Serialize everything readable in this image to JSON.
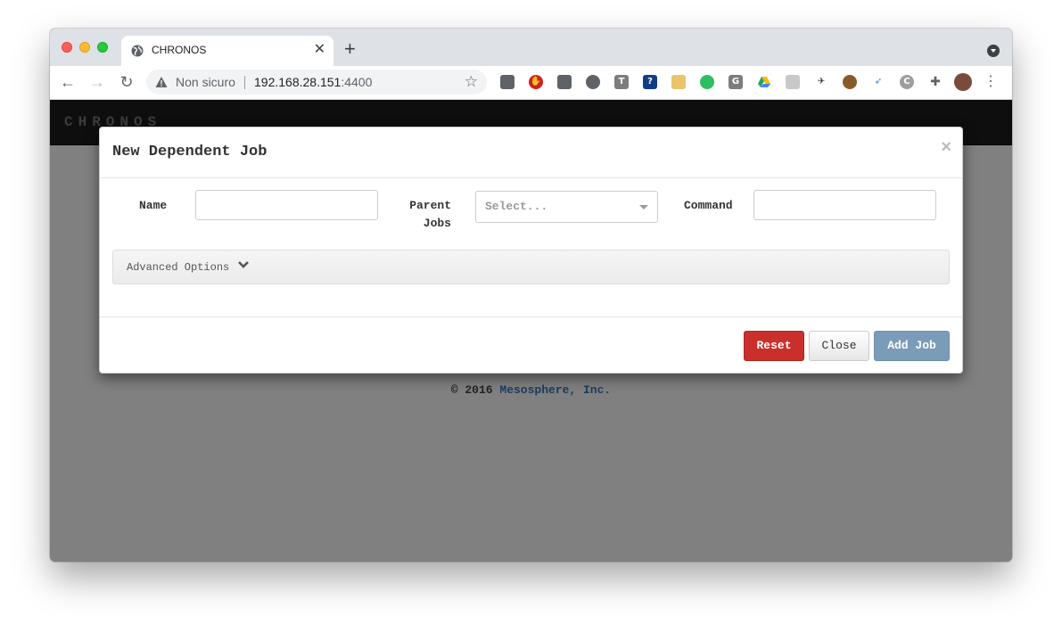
{
  "browser": {
    "tab_title": "CHRONOS",
    "not_secure_label": "Non sicuro",
    "url_host": "192.168.28.151",
    "url_port": ":4400"
  },
  "app": {
    "brand": "CHRONOS",
    "footer_prefix": "© 2016",
    "footer_link": "Mesosphere, Inc."
  },
  "modal": {
    "title": "New Dependent Job",
    "close_glyph": "×",
    "fields": {
      "name_label": "Name",
      "name_value": "",
      "parent_jobs_label_line1": "Parent",
      "parent_jobs_label_line2": "Jobs",
      "parent_jobs_placeholder": "Select...",
      "command_label": "Command",
      "command_value": ""
    },
    "advanced_label": "Advanced Options",
    "buttons": {
      "reset": "Reset",
      "close": "Close",
      "add_job": "Add Job"
    }
  },
  "colors": {
    "reset_button": "#c9302c",
    "add_job_button": "#7a9cb8",
    "footer_link": "#1d3b5e",
    "backdrop": "#808080"
  }
}
